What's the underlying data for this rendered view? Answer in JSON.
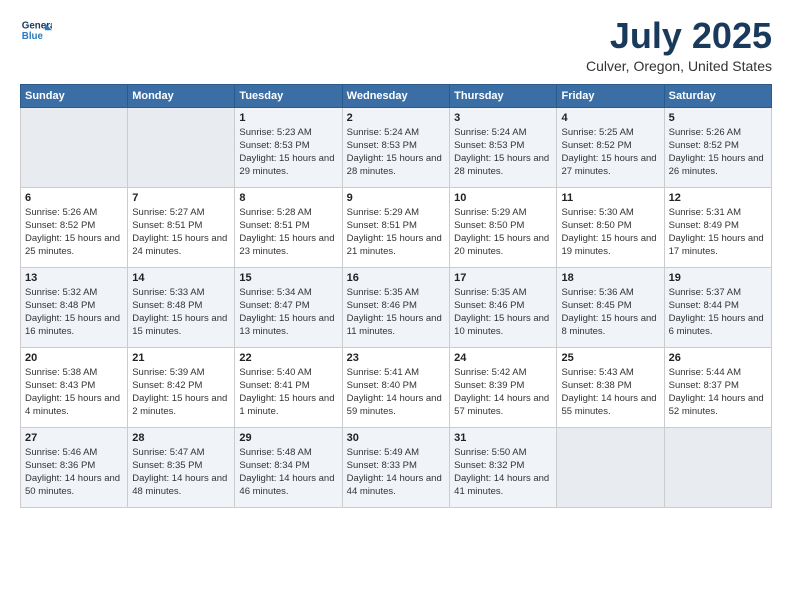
{
  "header": {
    "logo_line1": "General",
    "logo_line2": "Blue",
    "title": "July 2025",
    "subtitle": "Culver, Oregon, United States"
  },
  "weekdays": [
    "Sunday",
    "Monday",
    "Tuesday",
    "Wednesday",
    "Thursday",
    "Friday",
    "Saturday"
  ],
  "weeks": [
    [
      {
        "day": "",
        "sunrise": "",
        "sunset": "",
        "daylight": ""
      },
      {
        "day": "",
        "sunrise": "",
        "sunset": "",
        "daylight": ""
      },
      {
        "day": "1",
        "sunrise": "Sunrise: 5:23 AM",
        "sunset": "Sunset: 8:53 PM",
        "daylight": "Daylight: 15 hours and 29 minutes."
      },
      {
        "day": "2",
        "sunrise": "Sunrise: 5:24 AM",
        "sunset": "Sunset: 8:53 PM",
        "daylight": "Daylight: 15 hours and 28 minutes."
      },
      {
        "day": "3",
        "sunrise": "Sunrise: 5:24 AM",
        "sunset": "Sunset: 8:53 PM",
        "daylight": "Daylight: 15 hours and 28 minutes."
      },
      {
        "day": "4",
        "sunrise": "Sunrise: 5:25 AM",
        "sunset": "Sunset: 8:52 PM",
        "daylight": "Daylight: 15 hours and 27 minutes."
      },
      {
        "day": "5",
        "sunrise": "Sunrise: 5:26 AM",
        "sunset": "Sunset: 8:52 PM",
        "daylight": "Daylight: 15 hours and 26 minutes."
      }
    ],
    [
      {
        "day": "6",
        "sunrise": "Sunrise: 5:26 AM",
        "sunset": "Sunset: 8:52 PM",
        "daylight": "Daylight: 15 hours and 25 minutes."
      },
      {
        "day": "7",
        "sunrise": "Sunrise: 5:27 AM",
        "sunset": "Sunset: 8:51 PM",
        "daylight": "Daylight: 15 hours and 24 minutes."
      },
      {
        "day": "8",
        "sunrise": "Sunrise: 5:28 AM",
        "sunset": "Sunset: 8:51 PM",
        "daylight": "Daylight: 15 hours and 23 minutes."
      },
      {
        "day": "9",
        "sunrise": "Sunrise: 5:29 AM",
        "sunset": "Sunset: 8:51 PM",
        "daylight": "Daylight: 15 hours and 21 minutes."
      },
      {
        "day": "10",
        "sunrise": "Sunrise: 5:29 AM",
        "sunset": "Sunset: 8:50 PM",
        "daylight": "Daylight: 15 hours and 20 minutes."
      },
      {
        "day": "11",
        "sunrise": "Sunrise: 5:30 AM",
        "sunset": "Sunset: 8:50 PM",
        "daylight": "Daylight: 15 hours and 19 minutes."
      },
      {
        "day": "12",
        "sunrise": "Sunrise: 5:31 AM",
        "sunset": "Sunset: 8:49 PM",
        "daylight": "Daylight: 15 hours and 17 minutes."
      }
    ],
    [
      {
        "day": "13",
        "sunrise": "Sunrise: 5:32 AM",
        "sunset": "Sunset: 8:48 PM",
        "daylight": "Daylight: 15 hours and 16 minutes."
      },
      {
        "day": "14",
        "sunrise": "Sunrise: 5:33 AM",
        "sunset": "Sunset: 8:48 PM",
        "daylight": "Daylight: 15 hours and 15 minutes."
      },
      {
        "day": "15",
        "sunrise": "Sunrise: 5:34 AM",
        "sunset": "Sunset: 8:47 PM",
        "daylight": "Daylight: 15 hours and 13 minutes."
      },
      {
        "day": "16",
        "sunrise": "Sunrise: 5:35 AM",
        "sunset": "Sunset: 8:46 PM",
        "daylight": "Daylight: 15 hours and 11 minutes."
      },
      {
        "day": "17",
        "sunrise": "Sunrise: 5:35 AM",
        "sunset": "Sunset: 8:46 PM",
        "daylight": "Daylight: 15 hours and 10 minutes."
      },
      {
        "day": "18",
        "sunrise": "Sunrise: 5:36 AM",
        "sunset": "Sunset: 8:45 PM",
        "daylight": "Daylight: 15 hours and 8 minutes."
      },
      {
        "day": "19",
        "sunrise": "Sunrise: 5:37 AM",
        "sunset": "Sunset: 8:44 PM",
        "daylight": "Daylight: 15 hours and 6 minutes."
      }
    ],
    [
      {
        "day": "20",
        "sunrise": "Sunrise: 5:38 AM",
        "sunset": "Sunset: 8:43 PM",
        "daylight": "Daylight: 15 hours and 4 minutes."
      },
      {
        "day": "21",
        "sunrise": "Sunrise: 5:39 AM",
        "sunset": "Sunset: 8:42 PM",
        "daylight": "Daylight: 15 hours and 2 minutes."
      },
      {
        "day": "22",
        "sunrise": "Sunrise: 5:40 AM",
        "sunset": "Sunset: 8:41 PM",
        "daylight": "Daylight: 15 hours and 1 minute."
      },
      {
        "day": "23",
        "sunrise": "Sunrise: 5:41 AM",
        "sunset": "Sunset: 8:40 PM",
        "daylight": "Daylight: 14 hours and 59 minutes."
      },
      {
        "day": "24",
        "sunrise": "Sunrise: 5:42 AM",
        "sunset": "Sunset: 8:39 PM",
        "daylight": "Daylight: 14 hours and 57 minutes."
      },
      {
        "day": "25",
        "sunrise": "Sunrise: 5:43 AM",
        "sunset": "Sunset: 8:38 PM",
        "daylight": "Daylight: 14 hours and 55 minutes."
      },
      {
        "day": "26",
        "sunrise": "Sunrise: 5:44 AM",
        "sunset": "Sunset: 8:37 PM",
        "daylight": "Daylight: 14 hours and 52 minutes."
      }
    ],
    [
      {
        "day": "27",
        "sunrise": "Sunrise: 5:46 AM",
        "sunset": "Sunset: 8:36 PM",
        "daylight": "Daylight: 14 hours and 50 minutes."
      },
      {
        "day": "28",
        "sunrise": "Sunrise: 5:47 AM",
        "sunset": "Sunset: 8:35 PM",
        "daylight": "Daylight: 14 hours and 48 minutes."
      },
      {
        "day": "29",
        "sunrise": "Sunrise: 5:48 AM",
        "sunset": "Sunset: 8:34 PM",
        "daylight": "Daylight: 14 hours and 46 minutes."
      },
      {
        "day": "30",
        "sunrise": "Sunrise: 5:49 AM",
        "sunset": "Sunset: 8:33 PM",
        "daylight": "Daylight: 14 hours and 44 minutes."
      },
      {
        "day": "31",
        "sunrise": "Sunrise: 5:50 AM",
        "sunset": "Sunset: 8:32 PM",
        "daylight": "Daylight: 14 hours and 41 minutes."
      },
      {
        "day": "",
        "sunrise": "",
        "sunset": "",
        "daylight": ""
      },
      {
        "day": "",
        "sunrise": "",
        "sunset": "",
        "daylight": ""
      }
    ]
  ]
}
